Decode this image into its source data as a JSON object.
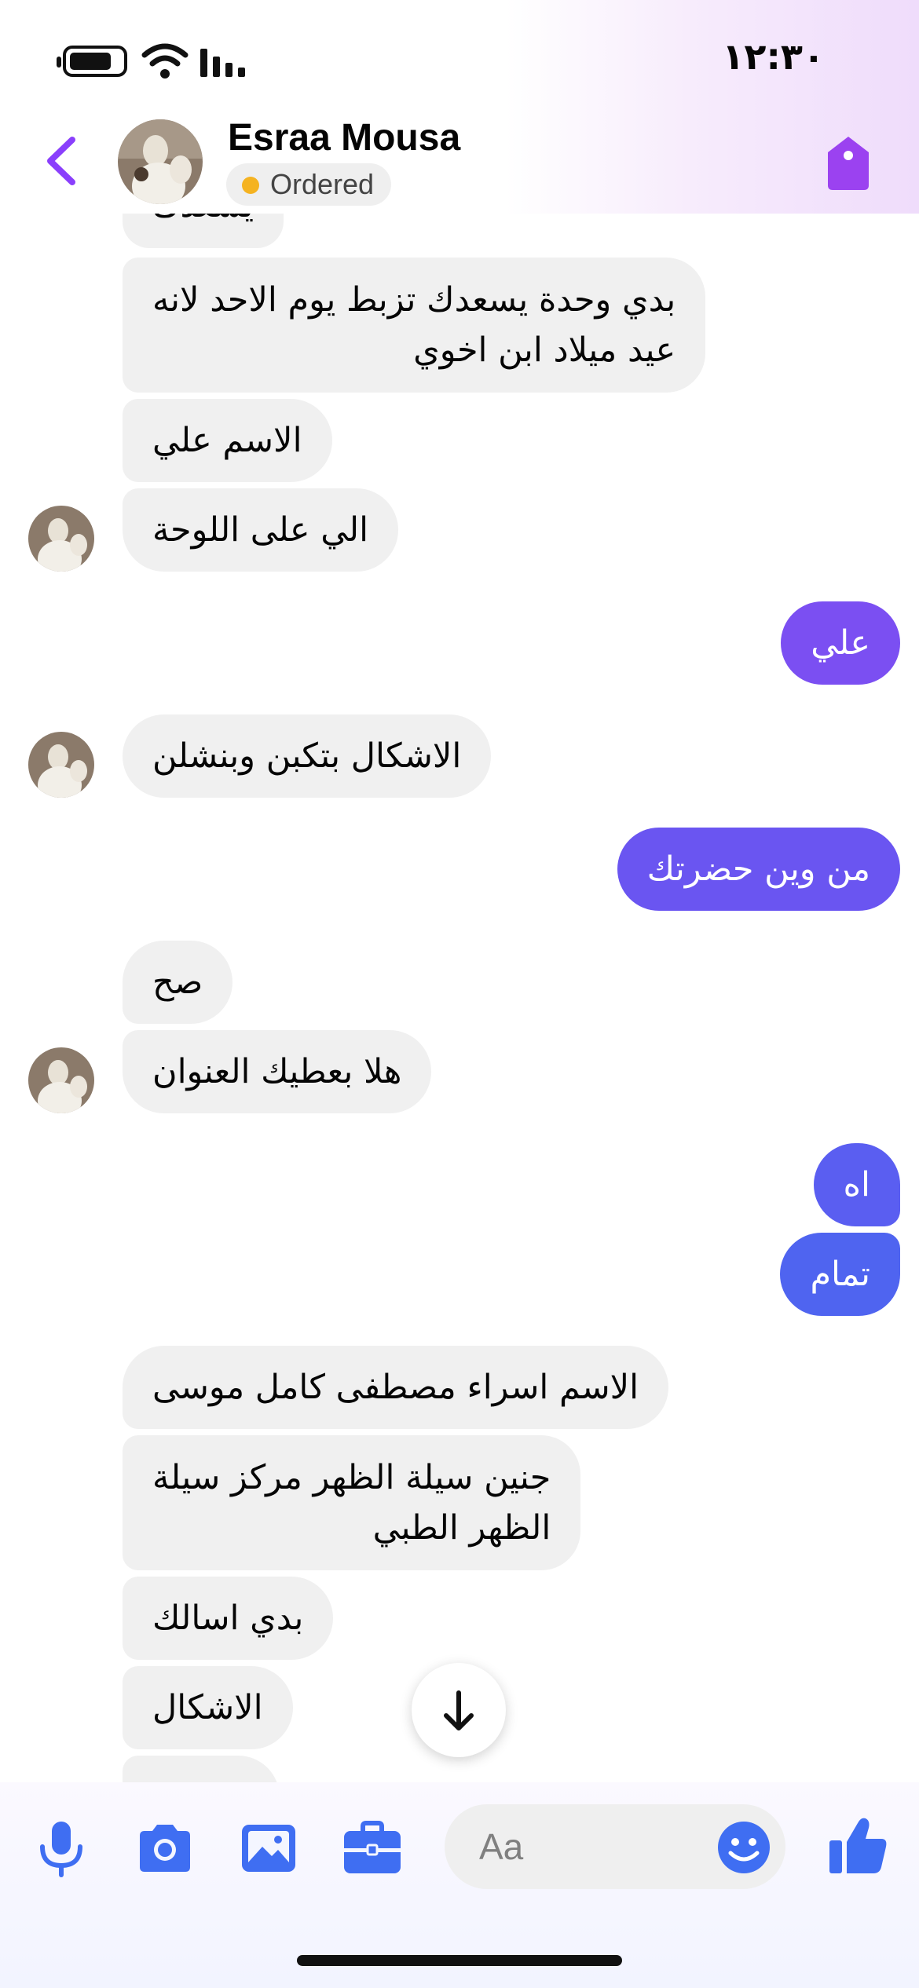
{
  "status_bar": {
    "time": "١٢:٣٠"
  },
  "header": {
    "contact_name": "Esraa Mousa",
    "order_status": "Ordered"
  },
  "messages": [
    {
      "dir": "in",
      "text": "يسعدك",
      "clipped": true
    },
    {
      "dir": "in",
      "lines": [
        "بدي وحدة يسعدك تزبط يوم الاحد لانه",
        "عيد ميلاد ابن اخوي"
      ]
    },
    {
      "dir": "in",
      "text": "الاسم علي"
    },
    {
      "dir": "in",
      "text": "الي على اللوحة"
    },
    {
      "dir": "out",
      "text": "علي"
    },
    {
      "dir": "in",
      "text": "الاشكال بتكبن وبنشلن"
    },
    {
      "dir": "out",
      "text": "من وين حضرتك"
    },
    {
      "dir": "in",
      "text": "صح"
    },
    {
      "dir": "in",
      "text": "هلا بعطيك العنوان"
    },
    {
      "dir": "out",
      "text": "اه"
    },
    {
      "dir": "out",
      "text": "تمام"
    },
    {
      "dir": "in",
      "text": "الاسم اسراء مصطفى كامل موسى"
    },
    {
      "dir": "in",
      "lines": [
        "جنين  سيلة الظهر مركز سيلة",
        "الظهر الطبي"
      ]
    },
    {
      "dir": "in",
      "text": "بدي اسالك"
    },
    {
      "dir": "in",
      "text": "الاشكال"
    },
    {
      "dir": "in",
      "text": "",
      "clipped": true
    }
  ],
  "composer": {
    "placeholder": "Aa"
  },
  "colors": {
    "accent_purple": "#8a3ffc",
    "outgoing_top": "#7b4ff2",
    "outgoing_bottom": "#4d66f0",
    "incoming_bg": "#f0f0f0",
    "icon_blue": "#3f6ef2",
    "status_dot": "#f5b321"
  },
  "icons": [
    "battery-icon",
    "wifi-icon",
    "signal-icon",
    "back-icon",
    "tag-icon",
    "microphone-icon",
    "camera-icon",
    "image-icon",
    "briefcase-icon",
    "emoji-icon",
    "thumbs-up-icon",
    "arrow-down-icon"
  ]
}
